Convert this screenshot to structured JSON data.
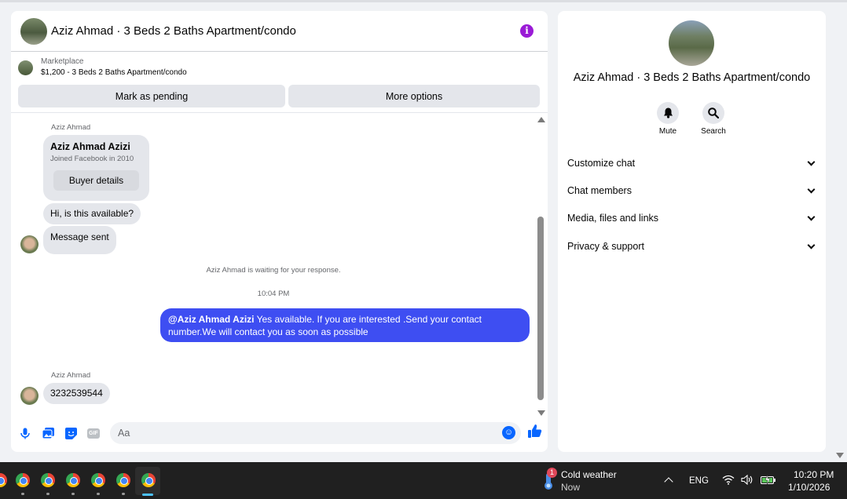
{
  "chat": {
    "title": "Aziz Ahmad · 3 Beds 2 Baths Apartment/condo",
    "listing": {
      "source": "Marketplace",
      "price_title": "$1,200 - 3 Beds 2 Baths Apartment/condo",
      "pending_label": "Mark as pending",
      "more_label": "More options"
    },
    "messages": {
      "sender1": "Aziz Ahmad",
      "profile_name": "Aziz Ahmad Azizi",
      "profile_joined": "Joined Facebook in 2010",
      "buyer_details": "Buyer details",
      "msg1": "Hi, is this available?",
      "msg2": "Message sent",
      "waiting": "Aziz Ahmad is waiting for your response.",
      "time": "10:04 PM",
      "reply_mention": "@Aziz Ahmad Azizi",
      "reply_text": " Yes available. If you are interested .Send your contact number.We will contact you as soon as possible",
      "sender2": "Aziz Ahmad",
      "msg3": "3232539544"
    },
    "composer": {
      "placeholder": "Aa",
      "gif_label": "GIF"
    }
  },
  "info": {
    "title": "Aziz Ahmad · 3 Beds 2 Baths Apartment/condo",
    "mute_label": "Mute",
    "search_label": "Search",
    "sections": [
      "Customize chat",
      "Chat members",
      "Media, files and links",
      "Privacy & support"
    ]
  },
  "taskbar": {
    "weather_title": "Cold weather",
    "weather_sub": "Now",
    "weather_badge": "1",
    "language": "ENG",
    "time": "10:20 PM",
    "date": "1/10/2026"
  },
  "colors": {
    "accent": "#0866ff",
    "outgoing_bubble": "#3e4ef2",
    "info_icon": "#9a1bd6"
  }
}
